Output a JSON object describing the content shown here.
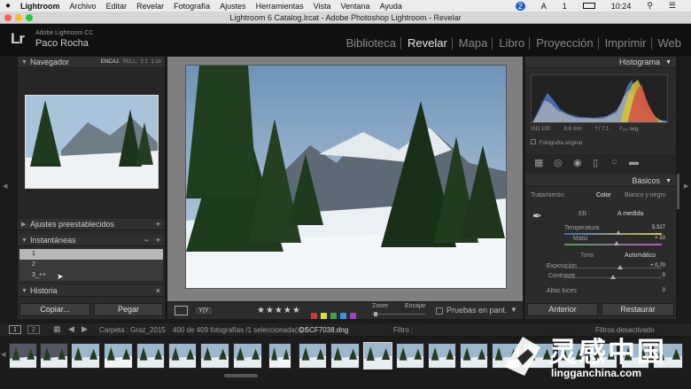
{
  "os_menu": {
    "apple": "",
    "app": "Lightroom",
    "items": [
      "Archivo",
      "Editar",
      "Revelar",
      "Fotografía",
      "Ajustes",
      "Herramientas",
      "Vista",
      "Ventana",
      "Ayuda"
    ],
    "status_badge": "2",
    "input_source": "A",
    "count": "1",
    "time": "10:24"
  },
  "window": {
    "title": "Lightroom 6 Catalog.lrcat - Adobe Photoshop Lightroom - Revelar"
  },
  "identity": {
    "logo": "Lr",
    "product": "Adobe Lightroom CC",
    "user": "Paco Rocha"
  },
  "modules": [
    {
      "label": "Biblioteca",
      "active": false
    },
    {
      "label": "Revelar",
      "active": true
    },
    {
      "label": "Mapa",
      "active": false
    },
    {
      "label": "Libro",
      "active": false
    },
    {
      "label": "Proyección",
      "active": false
    },
    {
      "label": "Imprimir",
      "active": false
    },
    {
      "label": "Web",
      "active": false
    }
  ],
  "left_panel": {
    "navigator": {
      "title": "Navegador",
      "zoom_options": [
        "ENCAJ.",
        "RELL.",
        "1:1",
        "1:16"
      ]
    },
    "presets": {
      "title": "Ajustes preestablecidos",
      "add": "+"
    },
    "snapshots": {
      "title": "Instantáneas",
      "minus": "−",
      "plus": "+",
      "items": [
        "1",
        "2",
        "3_++"
      ]
    },
    "history": {
      "title": "Historia",
      "close": "×"
    },
    "copy_button": "Copiar...",
    "paste_button": "Pegar"
  },
  "toolbar": {
    "view_xy": "Y|Y",
    "stars": "★★★★★",
    "flag_colors": [
      "#d33",
      "#dd3",
      "#3a3",
      "#39d",
      "#a3d"
    ],
    "zoom_label": "Zoom",
    "fit_label": "Encajar",
    "soft_proof": "Pruebas en pant."
  },
  "right_panel": {
    "histogram": {
      "title": "Histograma",
      "iso": "ISO 100",
      "focal": "8,6 mm",
      "aperture": "f / 7,1",
      "shutter": "¹⁄₁₂₅ seg.",
      "original": "Fotografía original"
    },
    "basic": {
      "title": "Básicos",
      "treatment_label": "Tratamiento:",
      "color": "Color",
      "bw": "Blanco y negro",
      "wb_label": "EB :",
      "wb_value": "A medida",
      "temp_label": "Temperatura",
      "temp_value": "5.317",
      "temp_level": 0.55,
      "tint_label": "Matiz",
      "tint_value": "+ 10",
      "tint_level": 0.54,
      "tone_label": "Tono",
      "auto_label": "Automático",
      "exposure_label": "Exposición",
      "exposure_value": "+ 0,70",
      "exposure_level": 0.57,
      "contrast_label": "Contraste",
      "contrast_value": "0",
      "contrast_level": 0.5,
      "highlights_label": "Altas luces",
      "highlights_value": "0"
    },
    "prev_button": "Anterior",
    "reset_button": "Restaurar"
  },
  "filmstrip_bar": {
    "screen1": "1",
    "screen2": "2",
    "folder": "Carpeta : Graz_2015",
    "count": "400 de 409 fotografías /1 seleccionada(s) /",
    "file": "DSCF7038.dng",
    "filter_label": "Filtro :",
    "filter_off": "Filtros desactivado"
  },
  "watermark": {
    "brand": "灵感中国",
    "url": "lingganchina.com"
  }
}
